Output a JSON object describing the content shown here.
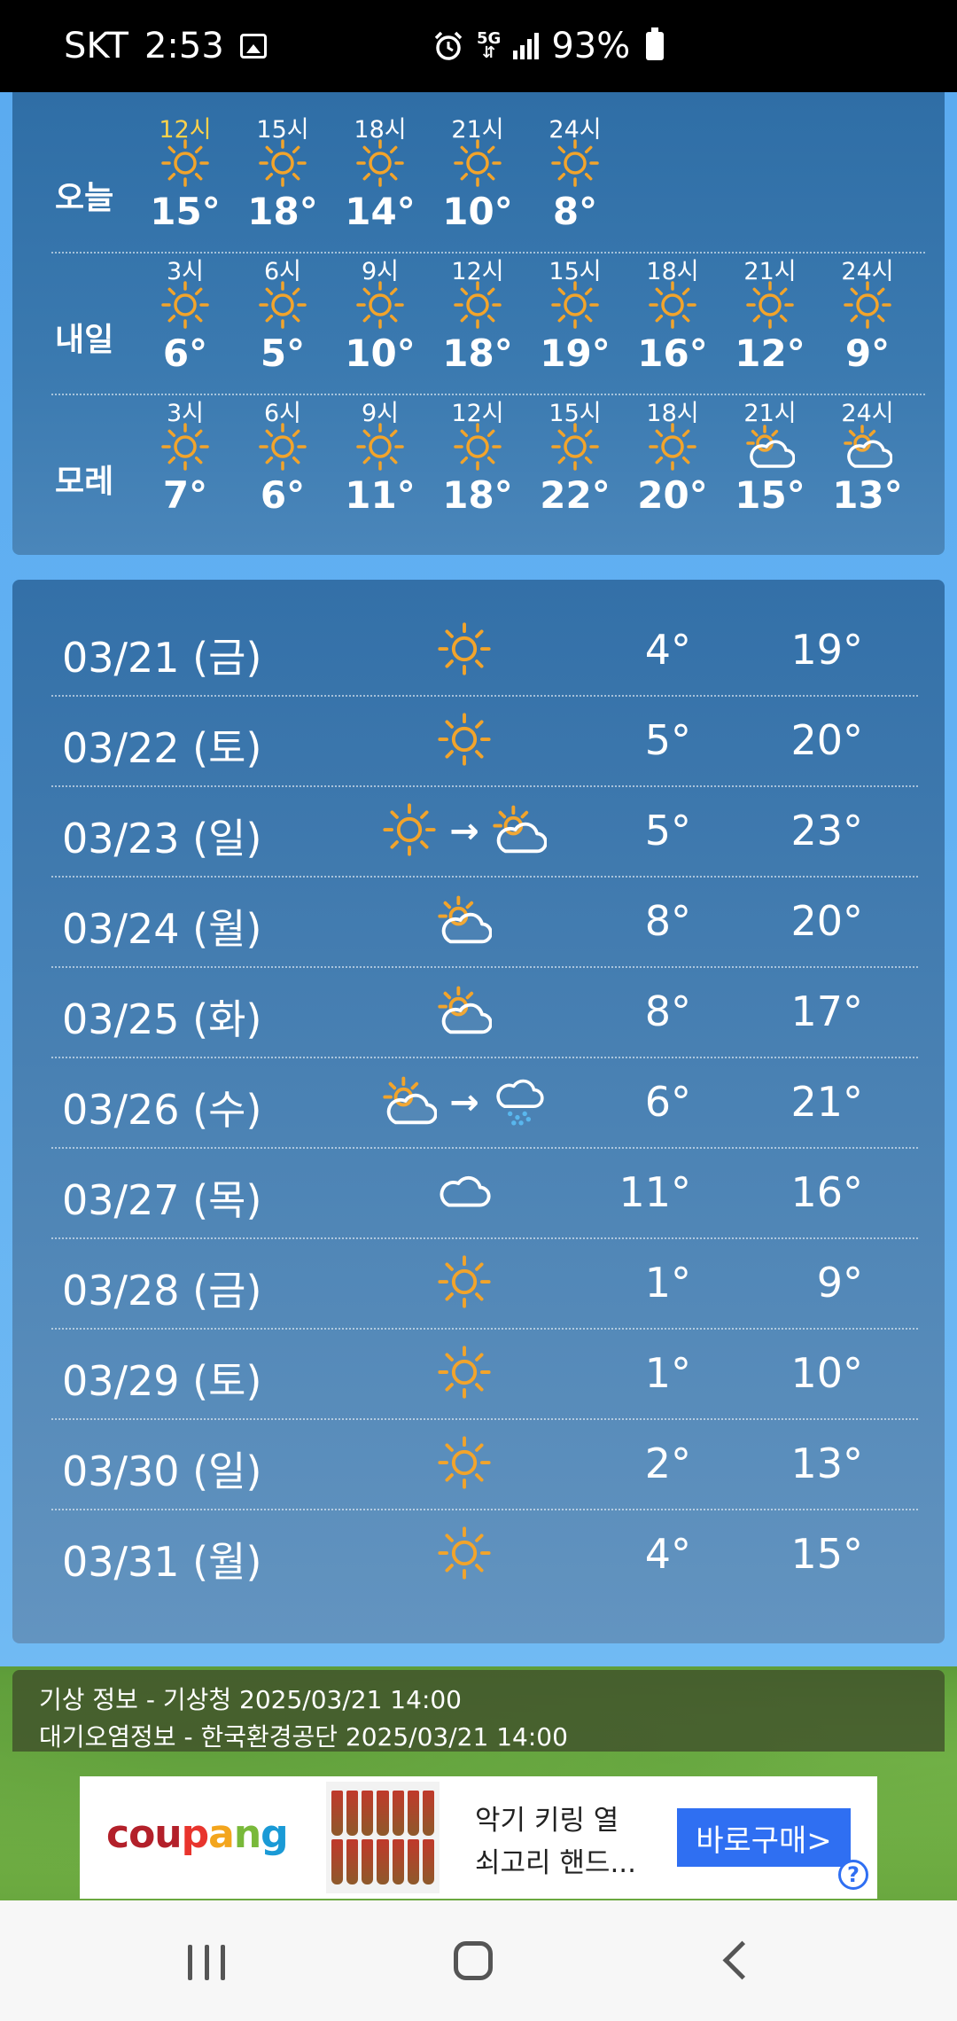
{
  "status_bar": {
    "carrier": "SKT",
    "time": "2:53",
    "network": "5G",
    "battery": "93%"
  },
  "colors": {
    "sun": "#f2a42b",
    "rain": "#59b7ee",
    "panel": "#3a78ae"
  },
  "hourly": [
    {
      "label": "오늘",
      "cells": [
        {
          "time": "12시",
          "icon": "sun-icon",
          "temp": "15°"
        },
        {
          "time": "15시",
          "icon": "sun-icon",
          "temp": "18°"
        },
        {
          "time": "18시",
          "icon": "sun-icon",
          "temp": "14°"
        },
        {
          "time": "21시",
          "icon": "sun-icon",
          "temp": "10°"
        },
        {
          "time": "24시",
          "icon": "sun-icon",
          "temp": "8°"
        }
      ]
    },
    {
      "label": "내일",
      "cells": [
        {
          "time": "3시",
          "icon": "sun-icon",
          "temp": "6°"
        },
        {
          "time": "6시",
          "icon": "sun-icon",
          "temp": "5°"
        },
        {
          "time": "9시",
          "icon": "sun-icon",
          "temp": "10°"
        },
        {
          "time": "12시",
          "icon": "sun-icon",
          "temp": "18°"
        },
        {
          "time": "15시",
          "icon": "sun-icon",
          "temp": "19°"
        },
        {
          "time": "18시",
          "icon": "sun-icon",
          "temp": "16°"
        },
        {
          "time": "21시",
          "icon": "sun-icon",
          "temp": "12°"
        },
        {
          "time": "24시",
          "icon": "sun-icon",
          "temp": "9°"
        }
      ]
    },
    {
      "label": "모레",
      "cells": [
        {
          "time": "3시",
          "icon": "sun-icon",
          "temp": "7°"
        },
        {
          "time": "6시",
          "icon": "sun-icon",
          "temp": "6°"
        },
        {
          "time": "9시",
          "icon": "sun-icon",
          "temp": "11°"
        },
        {
          "time": "12시",
          "icon": "sun-icon",
          "temp": "18°"
        },
        {
          "time": "15시",
          "icon": "sun-icon",
          "temp": "22°"
        },
        {
          "time": "18시",
          "icon": "sun-icon",
          "temp": "20°"
        },
        {
          "time": "21시",
          "icon": "partly-cloudy-icon",
          "temp": "15°"
        },
        {
          "time": "24시",
          "icon": "partly-cloudy-icon",
          "temp": "13°"
        }
      ]
    }
  ],
  "daily": [
    {
      "date": "03/21 (금)",
      "icons": [
        "sun-icon"
      ],
      "low": "4°",
      "high": "19°"
    },
    {
      "date": "03/22 (토)",
      "icons": [
        "sun-icon"
      ],
      "low": "5°",
      "high": "20°"
    },
    {
      "date": "03/23 (일)",
      "icons": [
        "sun-icon",
        "partly-cloudy-icon"
      ],
      "low": "5°",
      "high": "23°"
    },
    {
      "date": "03/24 (월)",
      "icons": [
        "partly-cloudy-icon"
      ],
      "low": "8°",
      "high": "20°"
    },
    {
      "date": "03/25 (화)",
      "icons": [
        "partly-cloudy-icon"
      ],
      "low": "8°",
      "high": "17°"
    },
    {
      "date": "03/26 (수)",
      "icons": [
        "partly-cloudy-icon",
        "rain-icon"
      ],
      "low": "6°",
      "high": "21°"
    },
    {
      "date": "03/27 (목)",
      "icons": [
        "cloud-icon"
      ],
      "low": "11°",
      "high": "16°"
    },
    {
      "date": "03/28 (금)",
      "icons": [
        "sun-icon"
      ],
      "low": "1°",
      "high": "9°"
    },
    {
      "date": "03/29 (토)",
      "icons": [
        "sun-icon"
      ],
      "low": "1°",
      "high": "10°"
    },
    {
      "date": "03/30 (일)",
      "icons": [
        "sun-icon"
      ],
      "low": "2°",
      "high": "13°"
    },
    {
      "date": "03/31 (월)",
      "icons": [
        "sun-icon"
      ],
      "low": "4°",
      "high": "15°"
    }
  ],
  "info": {
    "line1": "기상 정보 - 기상청 2025/03/21 14:00",
    "line2": "대기오염정보 - 한국환경공단 2025/03/21 14:00"
  },
  "ad": {
    "brand": [
      "cou",
      "p",
      "a",
      "n",
      "g"
    ],
    "text1": "악기 키링 열",
    "text2": "쇠고리 핸드...",
    "button": "바로구매>",
    "help": "?"
  }
}
